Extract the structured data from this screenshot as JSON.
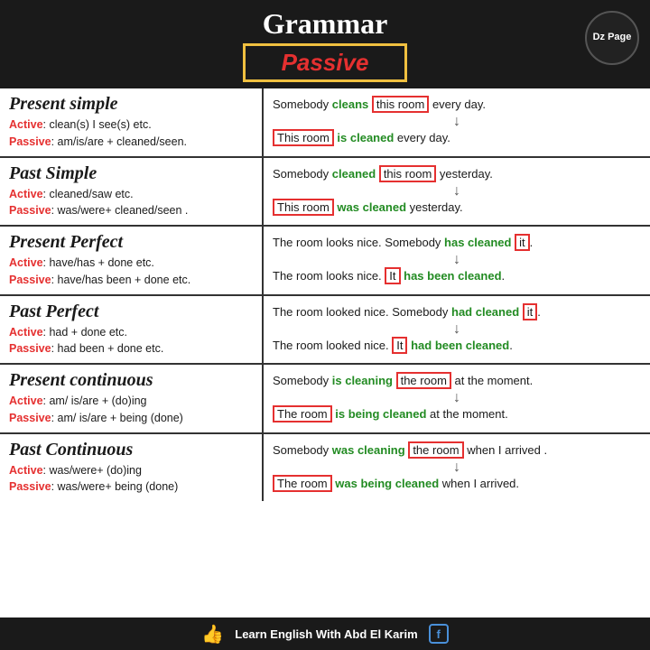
{
  "header": {
    "title": "Grammar",
    "passive": "Passive",
    "dz_page": "Dz Page"
  },
  "sections": [
    {
      "id": "present-simple",
      "title": "Present simple",
      "active_label": "Active",
      "active_rule": ": clean(s) I see(s) etc.",
      "passive_label": "Passive",
      "passive_rule": ": am/is/are + cleaned/seen.",
      "example_top": "Somebody ",
      "example_top_verb": "cleans",
      "example_top_boxed": "this room",
      "example_top_end": " every day.",
      "example_bot_boxed": "This room",
      "example_bot_verb": "is cleaned",
      "example_bot_end": " every day."
    },
    {
      "id": "past-simple",
      "title": "Past Simple",
      "active_label": "Active",
      "active_rule": ": cleaned/saw etc.",
      "passive_label": "Passive",
      "passive_rule": ": was/were+ cleaned/seen .",
      "example_top": "Somebody ",
      "example_top_verb": "cleaned",
      "example_top_boxed": "this room",
      "example_top_end": " yesterday.",
      "example_bot_boxed": "This room",
      "example_bot_verb": "was cleaned",
      "example_bot_end": " yesterday."
    },
    {
      "id": "present-perfect",
      "title": "Present Perfect",
      "active_label": "Active",
      "active_rule": ": have/has + done etc.",
      "passive_label": "Passive",
      "passive_rule": ": have/has been + done etc.",
      "example_top": "The room looks nice. Somebody ",
      "example_top_verb": "has cleaned",
      "example_top_boxed": "it",
      "example_top_end": ".",
      "example_bot_pre": "The room looks nice. ",
      "example_bot_boxed": "It",
      "example_bot_verb": "has been cleaned",
      "example_bot_end": "."
    },
    {
      "id": "past-perfect",
      "title": "Past Perfect",
      "active_label": "Active",
      "active_rule": ": had + done etc.",
      "passive_label": "Passive",
      "passive_rule": ": had been + done etc.",
      "example_top": "The room looked nice. Somebody ",
      "example_top_verb": "had cleaned",
      "example_top_boxed": "it",
      "example_top_end": ".",
      "example_bot_pre": "The room looked nice. ",
      "example_bot_boxed": "It",
      "example_bot_verb": "had been cleaned",
      "example_bot_end": "."
    },
    {
      "id": "present-continuous",
      "title": "Present continuous",
      "active_label": "Active",
      "active_rule": ": am/ is/are + (do)ing",
      "passive_label": "Passive",
      "passive_rule": ": am/ is/are + being (done)",
      "example_top": "Somebody ",
      "example_top_verb": "is cleaning",
      "example_top_boxed": "the room",
      "example_top_end": " at the moment.",
      "example_bot_boxed": "The room",
      "example_bot_verb": "is being cleaned",
      "example_bot_end": " at the moment."
    },
    {
      "id": "past-continuous",
      "title": "Past Continuous",
      "active_label": "Active",
      "active_rule": ": was/were+ (do)ing",
      "passive_label": "Passive",
      "passive_rule": ": was/were+ being (done)",
      "example_top": "Somebody ",
      "example_top_verb": "was cleaning",
      "example_top_boxed": "the room",
      "example_top_end": " when I arrived .",
      "example_bot_boxed": "The room",
      "example_bot_verb": "was being cleaned",
      "example_bot_end": " when I arrived."
    }
  ],
  "footer": {
    "text": "Learn English With Abd El Karim",
    "like_icon": "👍",
    "fb_label": "f"
  }
}
